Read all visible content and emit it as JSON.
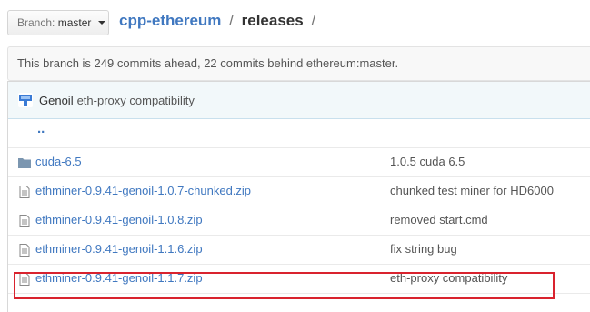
{
  "topbar": {
    "branch_prefix": "Branch:",
    "branch_name": "master",
    "repo": "cpp-ethereum",
    "separator": "/",
    "directory": "releases",
    "trailing_separator": "/"
  },
  "compare": {
    "text": "This branch is 249 commits ahead, 22 commits behind ethereum:master."
  },
  "latest_commit": {
    "author": "Genoil",
    "message": "eth-proxy compatibility",
    "icon": "commit-avatar-icon"
  },
  "files": {
    "parent_dir": "..",
    "rows": [
      {
        "name": "cuda-6.5",
        "type": "folder",
        "message": "1.0.5 cuda 6.5"
      },
      {
        "name": "ethminer-0.9.41-genoil-1.0.7-chunked.zip",
        "type": "file",
        "message": "chunked test miner for HD6000"
      },
      {
        "name": "ethminer-0.9.41-genoil-1.0.8.zip",
        "type": "file",
        "message": "removed start.cmd"
      },
      {
        "name": "ethminer-0.9.41-genoil-1.1.6.zip",
        "type": "file",
        "message": "fix string bug"
      },
      {
        "name": "ethminer-0.9.41-genoil-1.1.7.zip",
        "type": "file",
        "message": "eth-proxy compatibility"
      }
    ]
  },
  "colors": {
    "link": "#4078c0",
    "highlight": "#d9232e",
    "folder_icon": "#7b96b0"
  }
}
